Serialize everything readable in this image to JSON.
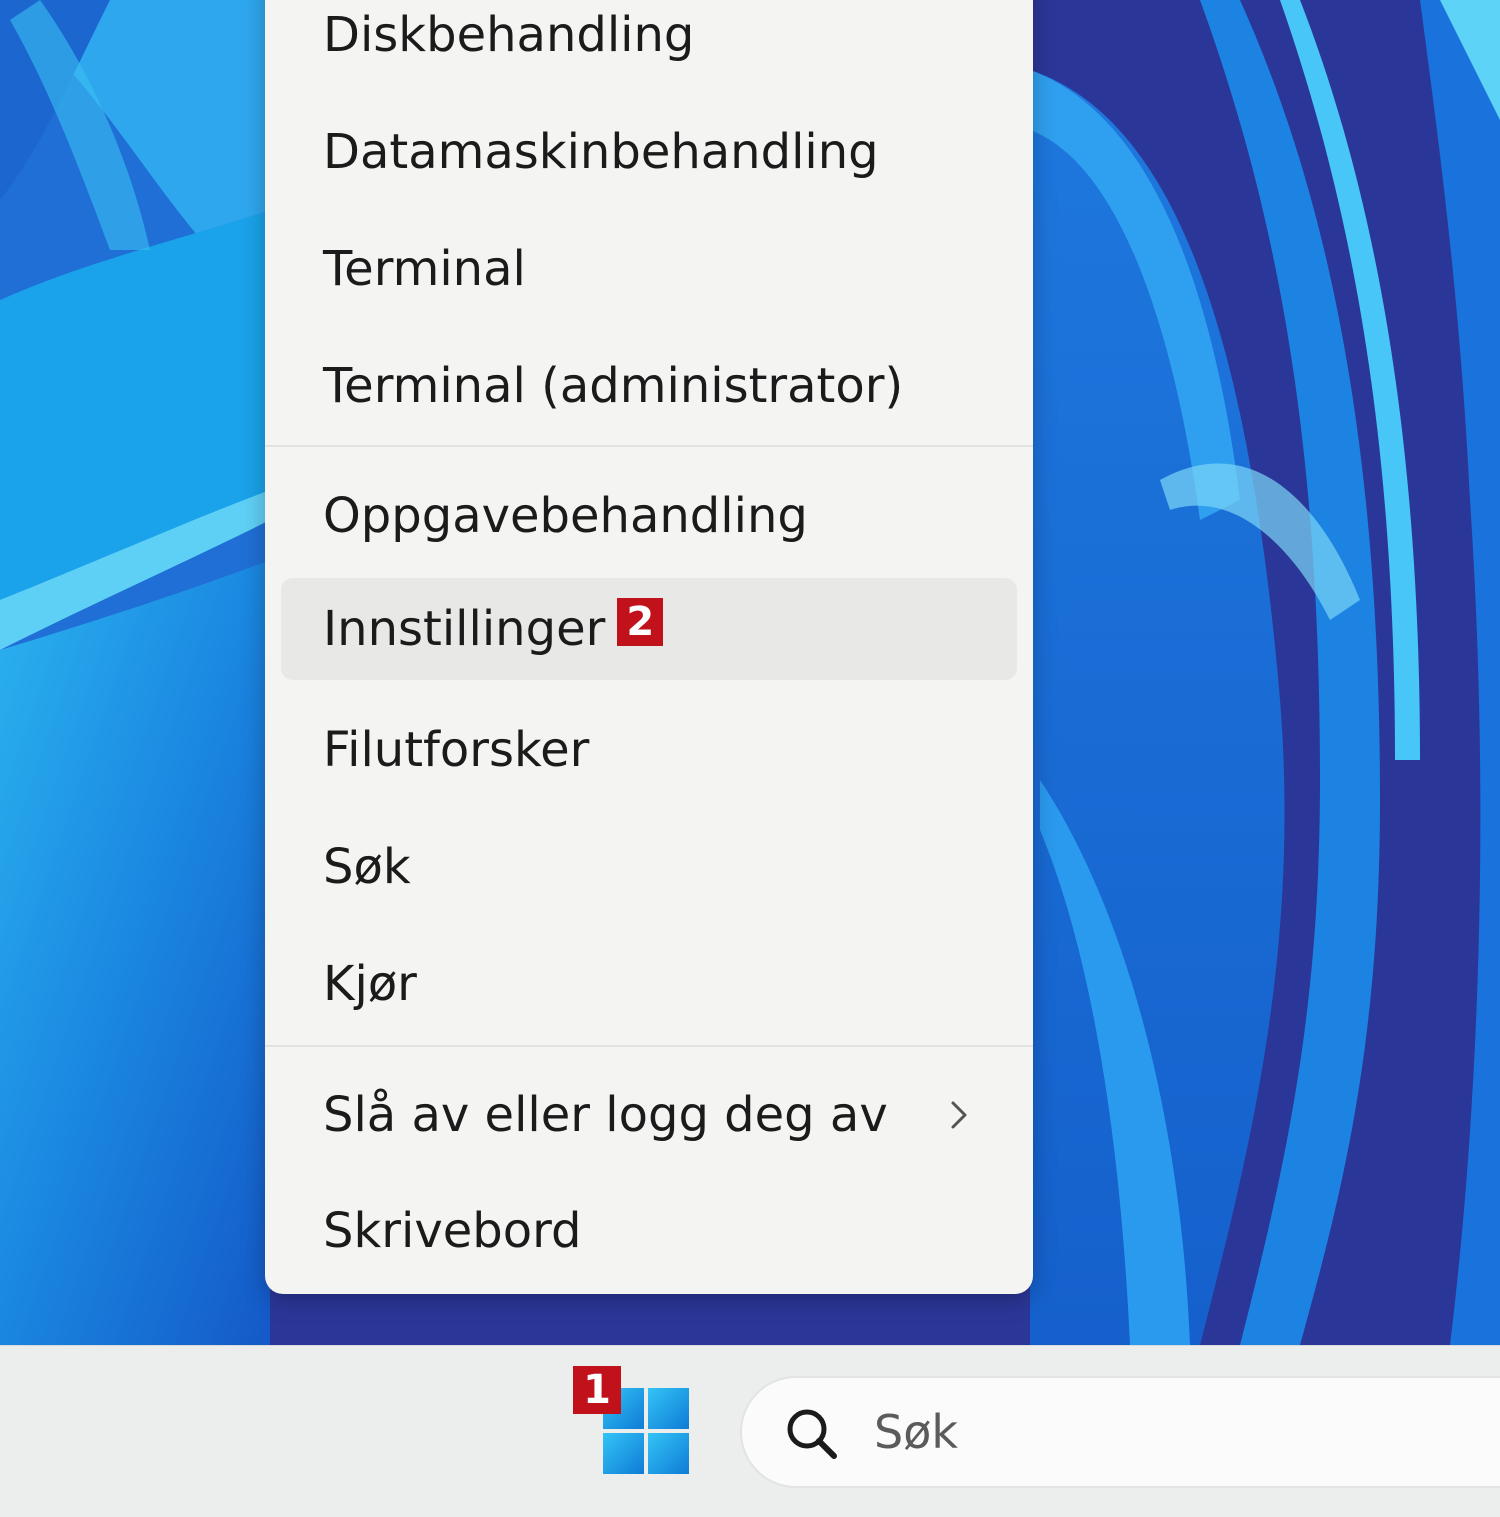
{
  "menu": {
    "items": [
      {
        "label": "Diskbehandling"
      },
      {
        "label": "Datamaskinbehandling"
      },
      {
        "label": "Terminal"
      },
      {
        "label": "Terminal (administrator)"
      },
      {
        "label": "Oppgavebehandling"
      },
      {
        "label": "Innstillinger",
        "badge": "2",
        "highlighted": true
      },
      {
        "label": "Filutforsker"
      },
      {
        "label": "Søk"
      },
      {
        "label": "Kjør"
      },
      {
        "label": "Slå av eller logg deg av",
        "has_submenu": true
      },
      {
        "label": "Skrivebord"
      }
    ]
  },
  "taskbar": {
    "start_badge": "1",
    "search_placeholder": "Søk"
  },
  "colors": {
    "badge": "#c1121c",
    "menu_bg": "#f4f4f2",
    "wallpaper_base": "#2a3a9e",
    "accent_blue": "#1a9be0"
  },
  "icons": {
    "start": "windows-start-icon",
    "search": "search-icon",
    "submenu": "chevron-right-icon"
  }
}
